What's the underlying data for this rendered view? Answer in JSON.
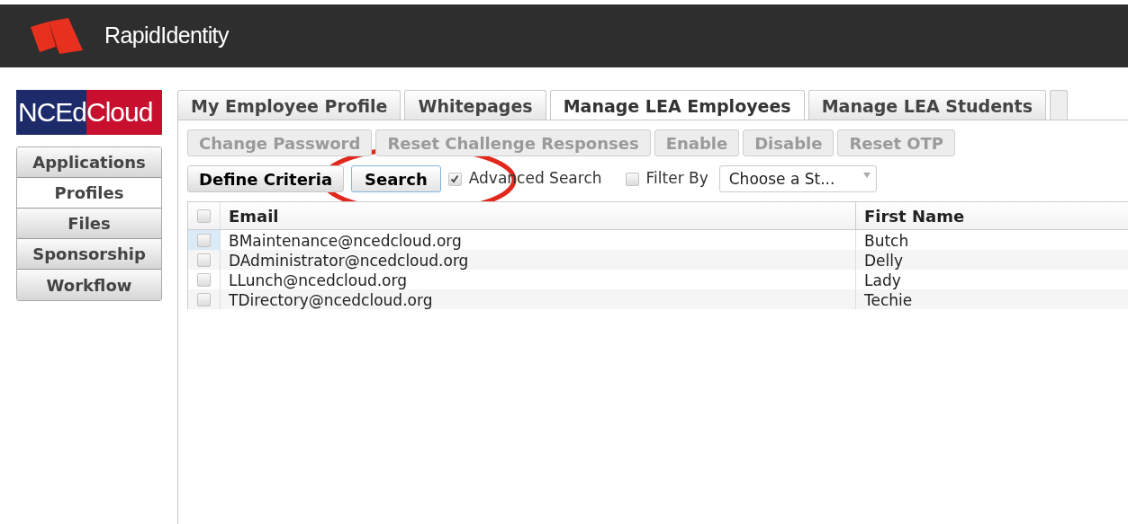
{
  "header": {
    "title": "RapidIdentity"
  },
  "brand": {
    "left": "NCEd",
    "right": "Cloud"
  },
  "sidebar": {
    "items": [
      {
        "label": "Applications",
        "selected": false
      },
      {
        "label": "Profiles",
        "selected": true
      },
      {
        "label": "Files",
        "selected": false
      },
      {
        "label": "Sponsorship",
        "selected": false
      },
      {
        "label": "Workflow",
        "selected": false
      }
    ]
  },
  "tabs": [
    {
      "label": "My Employee Profile",
      "selected": false
    },
    {
      "label": "Whitepages",
      "selected": false
    },
    {
      "label": "Manage LEA Employees",
      "selected": true
    },
    {
      "label": "Manage LEA Students",
      "selected": false
    }
  ],
  "actions": [
    {
      "label": "Change Password",
      "disabled": true
    },
    {
      "label": "Reset Challenge Responses",
      "disabled": true
    },
    {
      "label": "Enable",
      "disabled": true
    },
    {
      "label": "Disable",
      "disabled": true
    },
    {
      "label": "Reset OTP",
      "disabled": true
    }
  ],
  "search_bar": {
    "define_button": "Define Criteria",
    "search_button": "Search",
    "advanced": {
      "label": "Advanced Search",
      "checked": true
    },
    "filter": {
      "label": "Filter By",
      "checked": false
    },
    "state_select": {
      "value": "Choose a St..."
    }
  },
  "table": {
    "select_all": {
      "checked": false
    },
    "columns": [
      "Email",
      "First Name"
    ],
    "rows": [
      {
        "cells": [
          "BMaintenance@ncedcloud.org",
          "Butch"
        ],
        "checked": false
      },
      {
        "cells": [
          "DAdministrator@ncedcloud.org",
          "Delly"
        ],
        "checked": false
      },
      {
        "cells": [
          "LLunch@ncedcloud.org",
          "Lady"
        ],
        "checked": false
      },
      {
        "cells": [
          "TDirectory@ncedcloud.org",
          "Techie"
        ],
        "checked": false
      }
    ]
  }
}
